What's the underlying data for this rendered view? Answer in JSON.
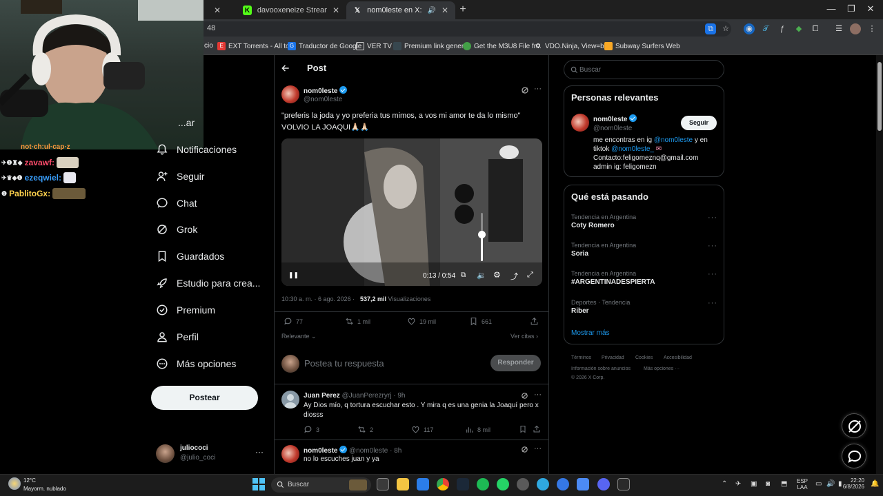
{
  "browser": {
    "tabs": [
      {
        "title": "davooxeneize Stream - Watch Liv",
        "favicon": "kick-icon"
      },
      {
        "title": "nom0leste en X: \"\"preferis la joda",
        "favicon": "x-icon"
      }
    ],
    "new_tab_symbol": "+",
    "window_controls": {
      "minimize": "—",
      "maximize": "❐",
      "close": "✕"
    },
    "address_fragment": "48",
    "bookmarks": [
      {
        "label": "cio",
        "icon": "folder-icon"
      },
      {
        "label": "EXT Torrents - All to...",
        "icon": "ext-torrents-icon"
      },
      {
        "label": "Traductor de Google",
        "icon": "translate-icon"
      },
      {
        "label": "VER TV",
        "icon": "folder-icon"
      },
      {
        "label": "Premium link gener...",
        "icon": "link-icon"
      },
      {
        "label": "Get the M3U8 File fr...",
        "icon": "m3u8-icon"
      },
      {
        "label": "VDO.Ninja, View=b...",
        "icon": "ninja-icon"
      },
      {
        "label": "Subway Surfers Web",
        "icon": "subway-icon"
      }
    ]
  },
  "overlay": {
    "partial_top_name": "not·ch:ul·cap·z",
    "chat": [
      {
        "user": "zavawf:",
        "color": "#ff4d6d"
      },
      {
        "user": "ezeqwiel:",
        "color": "#1e90ff"
      },
      {
        "user": "PablitoGx:",
        "color": "#ffd24d"
      }
    ]
  },
  "nav": {
    "items": [
      {
        "label": "...ar",
        "icon": "explore-icon"
      },
      {
        "label": "Notificaciones",
        "icon": "bell-icon"
      },
      {
        "label": "Seguir",
        "icon": "follow-icon"
      },
      {
        "label": "Chat",
        "icon": "chat-icon"
      },
      {
        "label": "Grok",
        "icon": "grok-icon"
      },
      {
        "label": "Guardados",
        "icon": "bookmark-icon"
      },
      {
        "label": "Estudio para crea...",
        "icon": "rocket-icon"
      },
      {
        "label": "Premium",
        "icon": "premium-icon"
      },
      {
        "label": "Perfil",
        "icon": "profile-icon"
      },
      {
        "label": "Más opciones",
        "icon": "more-circle-icon"
      }
    ],
    "post_button": "Postear",
    "account": {
      "name": "juliococi",
      "handle": "@julio_coci",
      "more": "···"
    }
  },
  "post": {
    "header": "Post",
    "author": {
      "name": "nom0leste",
      "handle": "@nom0leste"
    },
    "text_line1": "\"preferis la joda y yo preferia tus mimos, a vos mi amor te da lo mismo\"",
    "text_line2": "VOLVIO LA JOAQUI🙏🏻🙏🏻",
    "video": {
      "time": "0:13 / 0:54",
      "volume_fraction": 0.55
    },
    "timestamp": "10:30 a. m. · 6 ago. 2026 ·",
    "views_count": "537,2 mil",
    "views_label": "Visualizaciones",
    "stats": {
      "replies": "77",
      "reposts": "1 mil",
      "likes": "19 mil",
      "bookmarks": "661"
    },
    "sort_label": "Relevante",
    "quotes_label": "Ver citas",
    "reply_placeholder": "Postea tu respuesta",
    "reply_button": "Responder"
  },
  "replies": [
    {
      "name": "Juan Perez",
      "handle": "@JuanPerezryrj · 9h",
      "line1": "Ay Dios mío, q tortura escuchar esto . Y mira q es una genia la Joaquí pero x",
      "line2": "diosss",
      "stats": {
        "replies": "3",
        "reposts": "2",
        "likes": "117",
        "views": "8 mil"
      }
    },
    {
      "name": "nom0leste",
      "handle": "@nom0leste · 8h",
      "line1": "no lo escuches juan y ya"
    }
  ],
  "sidebar": {
    "search_placeholder": "Buscar",
    "relevant": {
      "title": "Personas relevantes",
      "name": "nom0leste",
      "handle": "@nom0leste",
      "follow": "Seguir",
      "bio_pre": "me encontras en ig ",
      "bio_ig": "@nom0leste",
      "bio_mid": " y en",
      "bio_pre2": "tiktok ",
      "bio_tiktok": "@nom0leste_",
      "bio_contact": "Contacto:feligomeznq@gmail.com",
      "bio_admin": "admin ig: feligomezn"
    },
    "trends": {
      "title": "Qué está pasando",
      "items": [
        {
          "category": "Tendencia en Argentina",
          "name": "Coty Romero"
        },
        {
          "category": "Tendencia en Argentina",
          "name": "Soria"
        },
        {
          "category": "Tendencia en Argentina",
          "name": "#ARGENTINADESPIERTA"
        },
        {
          "category": "Deportes · Tendencia",
          "name": "Riber"
        }
      ],
      "more": "Mostrar más"
    },
    "footer": {
      "line1": [
        "Términos",
        "Privacidad",
        "Cookies",
        "Accesibilidad"
      ],
      "line2": [
        "Información sobre anuncios",
        "Más opciones ···"
      ],
      "copyright": "© 2026 X Corp."
    }
  },
  "taskbar": {
    "weather_temp": "12°C",
    "weather_desc": "Mayorm. nublado",
    "search_placeholder": "Buscar",
    "lang1": "ESP",
    "lang2": "LAA",
    "time": "22:20",
    "date": "6/8/2026"
  },
  "colors": {
    "accent": "#1d9bf0",
    "bg": "#000000",
    "border": "#2f3336",
    "muted": "#71767b"
  }
}
